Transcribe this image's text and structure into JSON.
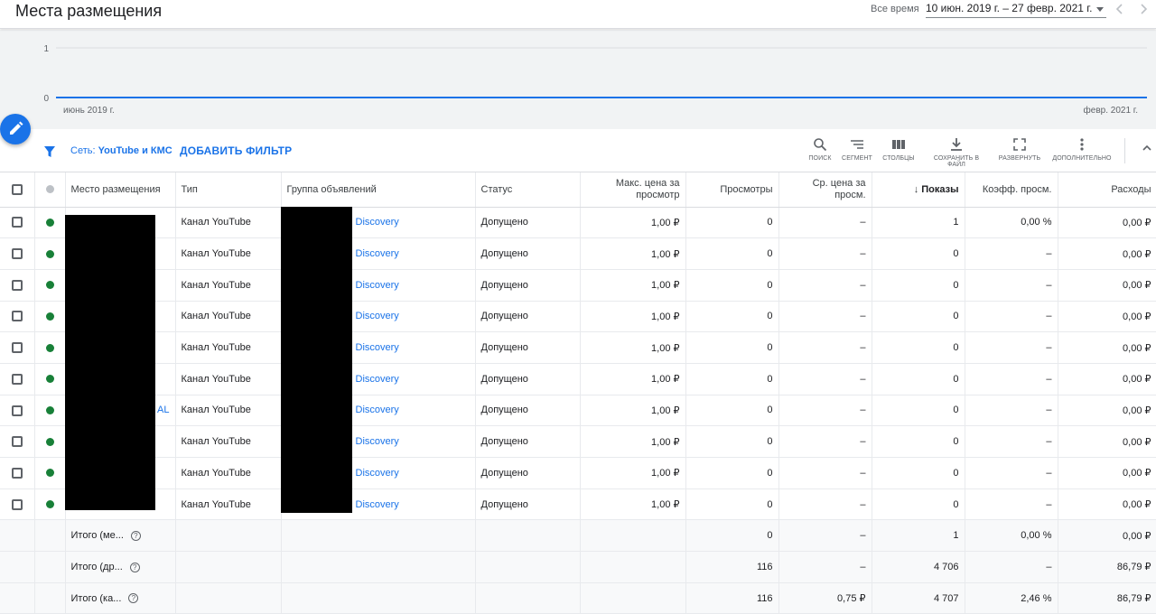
{
  "header": {
    "title": "Места размещения",
    "date_label": "Все время",
    "date_range": "10 июн. 2019 г. – 27 февр. 2021 г."
  },
  "chart_data": {
    "type": "line",
    "x": [
      "июнь 2019 г.",
      "февр. 2021 г."
    ],
    "series": [
      {
        "values": [
          0,
          0
        ]
      }
    ],
    "ylim": [
      0,
      1
    ],
    "yticks": [
      "0",
      "1"
    ],
    "xtick_labels": [
      "июнь 2019 г.",
      "февр. 2021 г."
    ],
    "grid": true,
    "color": "#1a73e8"
  },
  "filter": {
    "chip_prefix": "Сеть:",
    "chip_value": "YouTube и КМС",
    "add_filter_label": "ДОБАВИТЬ ФИЛЬТР"
  },
  "tools": [
    {
      "icon": "search-icon",
      "label": "ПОИСК"
    },
    {
      "icon": "segment-icon",
      "label": "СЕГМЕНТ"
    },
    {
      "icon": "columns-icon",
      "label": "СТОЛБЦЫ"
    },
    {
      "icon": "download-icon",
      "label": "СОХРАНИТЬ В ФАЙЛ"
    },
    {
      "icon": "fullscreen-icon",
      "label": "РАЗВЕРНУТЬ"
    },
    {
      "icon": "more-vert-icon",
      "label": "ДОПОЛНИТЕЛЬНО"
    }
  ],
  "colors": {
    "accent": "#1a73e8",
    "status_green": "#188038"
  },
  "table": {
    "columns": {
      "placement": "Место размещения",
      "type": "Тип",
      "ad_group": "Группа объявлений",
      "status": "Статус",
      "max_cpv": "Макс. цена за просмотр",
      "views": "Просмотры",
      "avg_cpv": "Ср. цена за просм.",
      "impressions": "Показы",
      "view_rate": "Коэфф. просм.",
      "cost": "Расходы"
    },
    "rows": [
      {
        "placement": "",
        "type": "Канал YouTube",
        "ad_group": "Discovery",
        "status": "Допущено",
        "max_cpv": "1,00 ₽",
        "views": "0",
        "avg_cpv": "–",
        "impressions": "1",
        "view_rate": "0,00 %",
        "cost": "0,00 ₽"
      },
      {
        "placement": "",
        "type": "Канал YouTube",
        "ad_group": "Discovery",
        "status": "Допущено",
        "max_cpv": "1,00 ₽",
        "views": "0",
        "avg_cpv": "–",
        "impressions": "0",
        "view_rate": "–",
        "cost": "0,00 ₽"
      },
      {
        "placement": "",
        "type": "Канал YouTube",
        "ad_group": "Discovery",
        "status": "Допущено",
        "max_cpv": "1,00 ₽",
        "views": "0",
        "avg_cpv": "–",
        "impressions": "0",
        "view_rate": "–",
        "cost": "0,00 ₽"
      },
      {
        "placement": "",
        "type": "Канал YouTube",
        "ad_group": "Discovery",
        "status": "Допущено",
        "max_cpv": "1,00 ₽",
        "views": "0",
        "avg_cpv": "–",
        "impressions": "0",
        "view_rate": "–",
        "cost": "0,00 ₽"
      },
      {
        "placement": "",
        "type": "Канал YouTube",
        "ad_group": "Discovery",
        "status": "Допущено",
        "max_cpv": "1,00 ₽",
        "views": "0",
        "avg_cpv": "–",
        "impressions": "0",
        "view_rate": "–",
        "cost": "0,00 ₽"
      },
      {
        "placement": "",
        "type": "Канал YouTube",
        "ad_group": "Discovery",
        "status": "Допущено",
        "max_cpv": "1,00 ₽",
        "views": "0",
        "avg_cpv": "–",
        "impressions": "0",
        "view_rate": "–",
        "cost": "0,00 ₽"
      },
      {
        "placement": "AL",
        "type": "Канал YouTube",
        "ad_group": "Discovery",
        "status": "Допущено",
        "max_cpv": "1,00 ₽",
        "views": "0",
        "avg_cpv": "–",
        "impressions": "0",
        "view_rate": "–",
        "cost": "0,00 ₽"
      },
      {
        "placement": "",
        "type": "Канал YouTube",
        "ad_group": "Discovery",
        "status": "Допущено",
        "max_cpv": "1,00 ₽",
        "views": "0",
        "avg_cpv": "–",
        "impressions": "0",
        "view_rate": "–",
        "cost": "0,00 ₽"
      },
      {
        "placement": "",
        "type": "Канал YouTube",
        "ad_group": "Discovery",
        "status": "Допущено",
        "max_cpv": "1,00 ₽",
        "views": "0",
        "avg_cpv": "–",
        "impressions": "0",
        "view_rate": "–",
        "cost": "0,00 ₽"
      },
      {
        "placement": "",
        "type": "Канал YouTube",
        "ad_group": "Discovery",
        "status": "Допущено",
        "max_cpv": "1,00 ₽",
        "views": "0",
        "avg_cpv": "–",
        "impressions": "0",
        "view_rate": "–",
        "cost": "0,00 ₽"
      }
    ],
    "totals": [
      {
        "label": "Итого (ме...",
        "views": "0",
        "avg_cpv": "–",
        "impressions": "1",
        "view_rate": "0,00 %",
        "cost": "0,00 ₽"
      },
      {
        "label": "Итого (др...",
        "views": "116",
        "avg_cpv": "–",
        "impressions": "4 706",
        "view_rate": "–",
        "cost": "86,79 ₽"
      },
      {
        "label": "Итого (ка...",
        "views": "116",
        "avg_cpv": "0,75 ₽",
        "impressions": "4 707",
        "view_rate": "2,46 %",
        "cost": "86,79 ₽"
      }
    ]
  }
}
